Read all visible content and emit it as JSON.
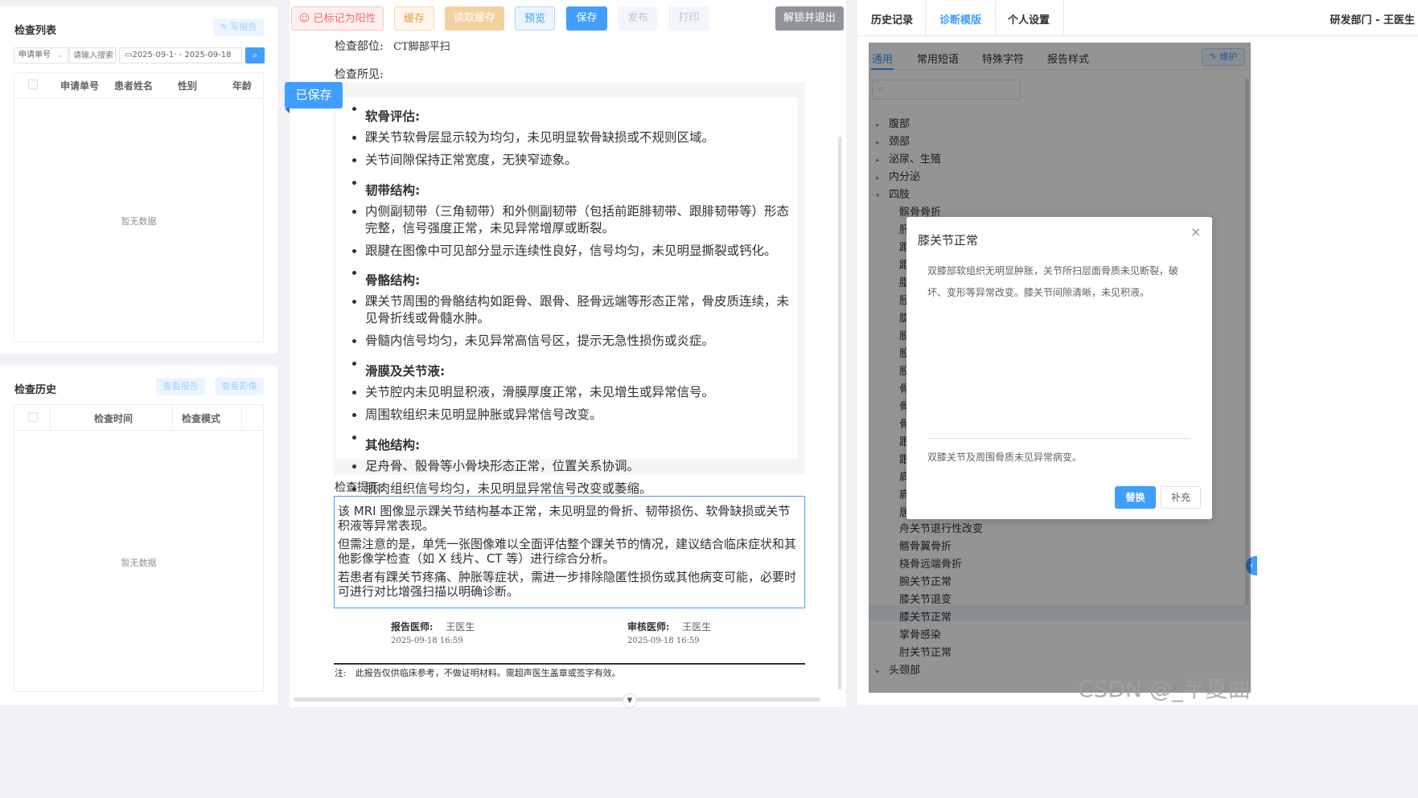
{
  "left": {
    "exam_list": {
      "title": "检查列表",
      "write_report_label": "写报告",
      "filter_select_value": "申请单号",
      "search_placeholder": "请输入搜索",
      "date_range": "2025-09-1· - 2025-09-18",
      "columns": [
        "申请单号",
        "患者姓名",
        "性别",
        "年龄"
      ],
      "empty_text": "暂无数据"
    },
    "exam_history": {
      "title": "检查历史",
      "view_report_label": "查看报告",
      "view_image_label": "查看影像",
      "columns": [
        "检查时间",
        "检查模式"
      ],
      "empty_text": "暂无数据"
    }
  },
  "toolbar": {
    "positive_label": "已标记为阳性",
    "cache_label": "缓存",
    "read_cache_label": "读取缓存",
    "preview_label": "预览",
    "save_label": "保存",
    "publish_label": "发布",
    "print_label": "打印",
    "unlock_exit_label": "解锁并退出"
  },
  "report": {
    "saved_badge": "已保存",
    "exam_part_label": "检查部位:",
    "exam_part_value": "CT脚部平扫",
    "findings_label": "检查所见:",
    "findings": [
      {
        "heading": "软骨评估",
        "items": [
          "踝关节软骨层显示较为均匀，未见明显软骨缺损或不规则区域。",
          "关节间隙保持正常宽度，无狭窄迹象。"
        ]
      },
      {
        "heading": "韧带结构",
        "items": [
          "内侧副韧带（三角韧带）和外侧副韧带（包括前距腓韧带、跟腓韧带等）形态完整，信号强度正常，未见异常增厚或断裂。",
          "跟腱在图像中可见部分显示连续性良好，信号均匀，未见明显撕裂或钙化。"
        ]
      },
      {
        "heading": "骨骼结构",
        "items": [
          "踝关节周围的骨骼结构如距骨、跟骨、胫骨远端等形态正常，骨皮质连续，未见骨折线或骨髓水肿。",
          "骨髓内信号均匀，未见异常高信号区，提示无急性损伤或炎症。"
        ]
      },
      {
        "heading": "滑膜及关节液",
        "items": [
          "关节腔内未见明显积液，滑膜厚度正常，未见增生或异常信号。",
          "周围软组织未见明显肿胀或异常信号改变。"
        ]
      },
      {
        "heading": "其他结构",
        "items": [
          "足舟骨、骰骨等小骨块形态正常，位置关系协调。",
          "肌肉组织信号均匀，未见明显异常信号改变或萎缩。"
        ]
      }
    ],
    "hints_label": "检查提示:",
    "hints": [
      "该 MRI 图像显示踝关节结构基本正常，未见明显的骨折、韧带损伤、软骨缺损或关节积液等异常表现。",
      "但需注意的是，单凭一张图像难以全面评估整个踝关节的情况，建议结合临床症状和其他影像学检查（如 X 线片、CT 等）进行综合分析。",
      "若患者有踝关节疼痛、肿胀等症状，需进一步排除隐匿性损伤或其他病变可能，必要时可进行对比增强扫描以明确诊断。"
    ],
    "report_doctor_label": "报告医师:",
    "report_doctor_name": "王医生",
    "report_time": "2025-09-18 16:59",
    "review_doctor_label": "审核医师:",
    "review_doctor_name": "王医生",
    "review_time": "2025-09-18 16:59",
    "note": "注:　此报告仅供临床参考，不做证明材料。需超声医生盖章或签字有效。"
  },
  "right": {
    "tabs": [
      "历史记录",
      "诊断模版",
      "个人设置"
    ],
    "active_tab": 1,
    "user": "研发部门 - 王医生",
    "subtabs": [
      "通用",
      "常用短语",
      "特殊字符",
      "报告样式"
    ],
    "maintain_label": "维护",
    "tree_top": [
      "腹部",
      "颈部",
      "泌尿、生殖",
      "内分泌",
      "四肢"
    ],
    "tree_children": [
      "髌骨骨折",
      "舟关节退行性改变",
      "髂骨翼骨折",
      "桡骨远端骨折",
      "腕关节正常",
      "膝关节退变",
      "膝关节正常",
      "掌骨感染",
      "肘关节正常"
    ],
    "tree_bottom": "头颈部",
    "partial_chars": [
      "肝",
      "距",
      "距",
      "脂",
      "胫",
      "肱",
      "股",
      "股",
      "股",
      "骨",
      "骨",
      "骨",
      "跟",
      "跟",
      "肩",
      "肩",
      "居"
    ]
  },
  "dialog": {
    "title": "膝关节正常",
    "findings": "双膝部软组织无明显肿胀，关节所扫层面骨质未见断裂，破坏、变形等异常改变。膝关节间隙清晰，未见积液。",
    "conclusion": "双膝关节及周围骨质未见异常病变。",
    "replace_label": "替换",
    "supplement_label": "补充"
  },
  "watermark": "CSDN @_半夏曲"
}
